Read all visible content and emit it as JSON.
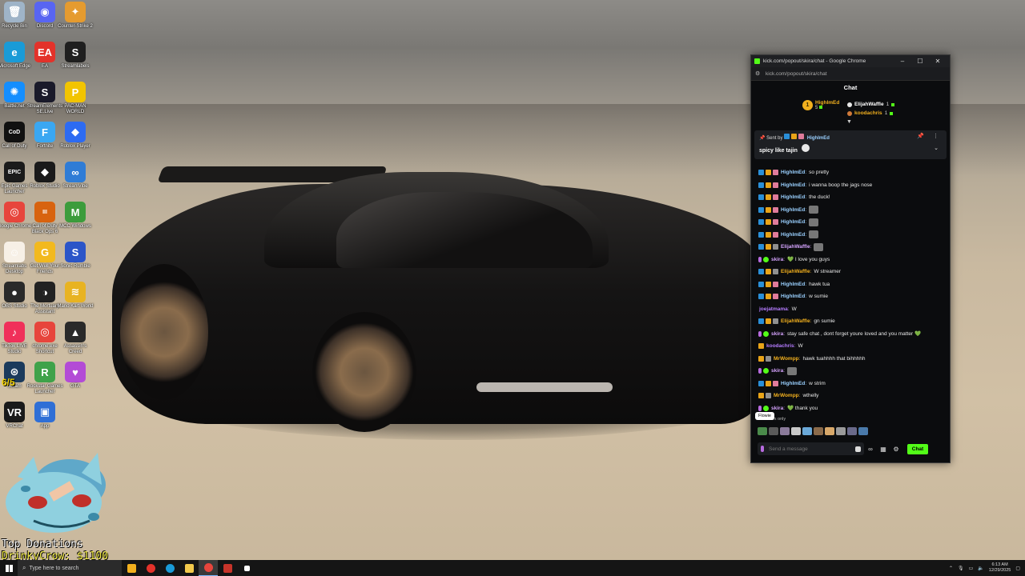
{
  "desktop_icons": [
    {
      "label": "Recycle Bin",
      "color": "#9fb4c8",
      "glyph": "🗑"
    },
    {
      "label": "Discord",
      "color": "#5865f2",
      "glyph": "◉"
    },
    {
      "label": "Counter-Strike 2",
      "color": "#e59b2f",
      "glyph": "✦"
    },
    {
      "label": "Microsoft Edge",
      "color": "#1a9bd7",
      "glyph": "e"
    },
    {
      "label": "EA",
      "color": "#e3322a",
      "glyph": "EA"
    },
    {
      "label": "Streamlabels",
      "color": "#1f1f1f",
      "glyph": "S"
    },
    {
      "label": "Battle.net",
      "color": "#148eff",
      "glyph": "✺"
    },
    {
      "label": "StreamElements SE.Live",
      "color": "#1a1a2a",
      "glyph": "S"
    },
    {
      "label": "PAC-MAN WORLD",
      "color": "#f2c400",
      "glyph": "P"
    },
    {
      "label": "Call of Duty",
      "color": "#111111",
      "glyph": "CoD"
    },
    {
      "label": "Fortnite",
      "color": "#3aa7f2",
      "glyph": "F"
    },
    {
      "label": "Roblox Player",
      "color": "#2d6bf2",
      "glyph": "◆"
    },
    {
      "label": "Epic Games Launcher",
      "color": "#1b1b1b",
      "glyph": "EPIC"
    },
    {
      "label": "Roblox Studio",
      "color": "#1a1a1a",
      "glyph": "◆"
    },
    {
      "label": "StreamVibe",
      "color": "#2f7cd6",
      "glyph": "∞"
    },
    {
      "label": "Google Chrome",
      "color": "#e7453c",
      "glyph": "◎"
    },
    {
      "label": "Call of Duty Black Ops 6",
      "color": "#d8630f",
      "glyph": "III"
    },
    {
      "label": "MCC Windows",
      "color": "#3c9c3c",
      "glyph": "M"
    },
    {
      "label": "Streamlabs Desktop",
      "color": "#f7f0e6",
      "glyph": "☺"
    },
    {
      "label": "Get Well Your Friends",
      "color": "#f2b91e",
      "glyph": "G"
    },
    {
      "label": "Sonic Rumble",
      "color": "#2b55c8",
      "glyph": "S"
    },
    {
      "label": "OBS Studio",
      "color": "#2a2a2a",
      "glyph": "●"
    },
    {
      "label": "The Mortuary Assistant",
      "color": "#222222",
      "glyph": "◑"
    },
    {
      "label": "Mario Kart World",
      "color": "#e8b322",
      "glyph": "≋"
    },
    {
      "label": "TikTok LIVE Studio",
      "color": "#f0305a",
      "glyph": "♪"
    },
    {
      "label": "chrome.exe Shortcut",
      "color": "#e7453c",
      "glyph": "◎"
    },
    {
      "label": "Assassin's Creed",
      "color": "#2a2a2a",
      "glyph": "▲"
    },
    {
      "label": "Steam",
      "color": "#1b3a5c",
      "glyph": "⊛"
    },
    {
      "label": "Rockstar Games Launcher",
      "color": "#3fa24a",
      "glyph": "R"
    },
    {
      "label": "GTA",
      "color": "#b34bd6",
      "glyph": "♥"
    },
    {
      "label": "VRChat",
      "color": "#1a1a1a",
      "glyph": "VR"
    },
    {
      "label": "App",
      "color": "#2f6fd6",
      "glyph": "▣"
    }
  ],
  "overlay": {
    "count": "6/5",
    "donations_title": "Top Donations",
    "donor": "DrinkyCrow:",
    "amount": "$1100"
  },
  "chrome": {
    "title": "kick.com/popout/skira/chat - Google Chrome",
    "url": "kick.com/popout/skira/chat",
    "minimize": "–",
    "maximize": "☐",
    "close": "✕"
  },
  "chat": {
    "header": "Chat",
    "leaderboard": {
      "first": {
        "rank": "1",
        "name": "HighImEd",
        "count": "5"
      },
      "second": {
        "name": "ElijahWaffle",
        "count": "1"
      },
      "third": {
        "name": "koodachris",
        "count": "1"
      }
    },
    "pinned": {
      "sent_by": "Sent by",
      "user": "HighImEd",
      "message": "spicy like tajin"
    },
    "messages": [
      {
        "user": "HighImEd",
        "color": "#9ad0ff",
        "badges": [
          "verified",
          "crown",
          "sub"
        ],
        "text": "so pretty",
        "emote": false
      },
      {
        "user": "HighImEd",
        "color": "#9ad0ff",
        "badges": [
          "verified",
          "crown",
          "sub"
        ],
        "text": "i wanna boop the jags nose",
        "emote": false
      },
      {
        "user": "HighImEd",
        "color": "#9ad0ff",
        "badges": [
          "verified",
          "crown",
          "sub"
        ],
        "text": "the duck!",
        "emote": false
      },
      {
        "user": "HighImEd",
        "color": "#9ad0ff",
        "badges": [
          "verified",
          "crown",
          "sub"
        ],
        "text": "",
        "emote": true
      },
      {
        "user": "HighImEd",
        "color": "#9ad0ff",
        "badges": [
          "verified",
          "crown",
          "sub"
        ],
        "text": "",
        "emote": true
      },
      {
        "user": "HighImEd",
        "color": "#9ad0ff",
        "badges": [
          "verified",
          "crown",
          "sub"
        ],
        "text": "",
        "emote": true
      },
      {
        "user": "ElijahWaffle",
        "color": "#d6a4ff",
        "badges": [
          "verified",
          "crown",
          "gift"
        ],
        "text": "",
        "emote": true
      },
      {
        "user": "skira",
        "color": "#d6a4ff",
        "badges": [
          "mic",
          "mod"
        ],
        "text": "💚 I love you guys",
        "emote": false
      },
      {
        "user": "ElijahWaffle",
        "color": "#f2b01e",
        "badges": [
          "verified",
          "crown",
          "gift"
        ],
        "text": "W streamer",
        "emote": false
      },
      {
        "user": "HighImEd",
        "color": "#9ad0ff",
        "badges": [
          "verified",
          "crown",
          "sub"
        ],
        "text": "hawk tua",
        "emote": false
      },
      {
        "user": "HighImEd",
        "color": "#9ad0ff",
        "badges": [
          "verified",
          "crown",
          "sub"
        ],
        "text": "w sumie",
        "emote": false
      },
      {
        "user": "joejatmama",
        "color": "#b57cff",
        "badges": [],
        "text": "W",
        "emote": false
      },
      {
        "user": "ElijahWaffle",
        "color": "#f2b01e",
        "badges": [
          "verified",
          "crown",
          "gift"
        ],
        "text": "gn sumie",
        "emote": false
      },
      {
        "user": "skira",
        "color": "#d6a4ff",
        "badges": [
          "mic",
          "mod"
        ],
        "text": "stay safe chat , dont forget youre loved and you matter 💚",
        "emote": false
      },
      {
        "user": "koodachris",
        "color": "#b57cff",
        "badges": [
          "crown"
        ],
        "text": "W",
        "emote": false
      },
      {
        "user": "MrWompp",
        "color": "#f2b01e",
        "badges": [
          "crown",
          "gift"
        ],
        "text": "hawk tuahhhh that bihhhhh",
        "emote": false
      },
      {
        "user": "skira",
        "color": "#d6a4ff",
        "badges": [
          "mic",
          "mod"
        ],
        "text": "",
        "emote": true
      },
      {
        "user": "HighImEd",
        "color": "#9ad0ff",
        "badges": [
          "verified",
          "crown",
          "sub"
        ],
        "text": "w strim",
        "emote": false
      },
      {
        "user": "MrWompp",
        "color": "#f2b01e",
        "badges": [
          "crown",
          "gift"
        ],
        "text": "wthelly",
        "emote": false
      },
      {
        "user": "skira",
        "color": "#d6a4ff",
        "badges": [
          "mic",
          "mod"
        ],
        "text": "💚 thank you",
        "emote": false
      }
    ],
    "tooltip": "Flowie",
    "followers_only": "Followers only",
    "input_placeholder": "Send a message",
    "chat_button": "Chat",
    "infinity": "∞"
  },
  "taskbar": {
    "search_placeholder": "Type here to search",
    "time": "6:13 AM",
    "date": "12/29/2025"
  },
  "colors": {
    "kick_green": "#53fc18",
    "gold": "#f2b01e",
    "chat_bg": "#0b0c0e"
  }
}
